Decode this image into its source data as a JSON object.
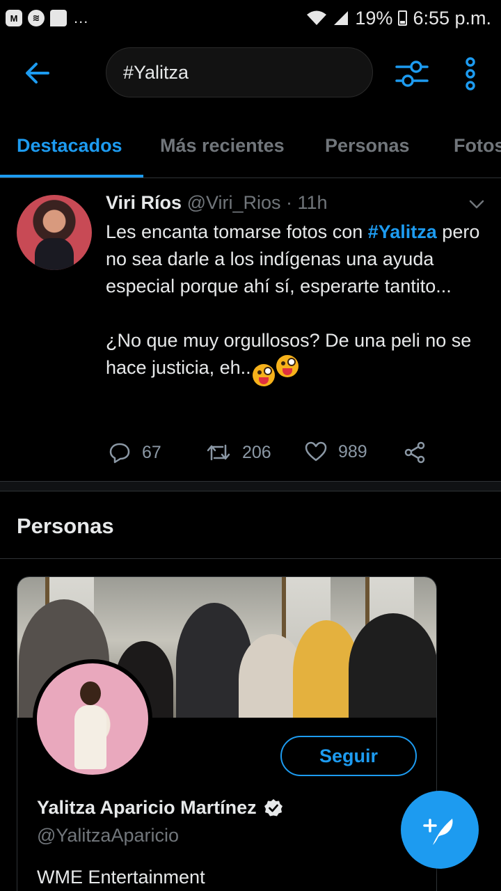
{
  "status_bar": {
    "app_icons": [
      "m-icon",
      "spotify-icon",
      "message-icon"
    ],
    "overflow": "...",
    "battery": "19%",
    "time": "6:55 p.m."
  },
  "search": {
    "query": "#Yalitza"
  },
  "tabs": [
    {
      "label": "Destacados",
      "active": true
    },
    {
      "label": "Más recientes",
      "active": false
    },
    {
      "label": "Personas",
      "active": false
    },
    {
      "label": "Fotos",
      "active": false
    }
  ],
  "tweet": {
    "name": "Viri Ríos",
    "handle": "@Viri_Rios",
    "separator": " · ",
    "time": "11h",
    "text_before": "Les encanta tomarse fotos con ",
    "hashtag": "#Yalitza",
    "text_after": " pero no sea darle a los indígenas una ayuda especial porque ahí sí, esperarte tantito...",
    "text_p2": "¿No que muy orgullosos? De una peli no se hace justicia, eh..",
    "emoji": "😜😜",
    "replies": "67",
    "retweets": "206",
    "likes": "989"
  },
  "personas": {
    "title": "Personas",
    "card": {
      "name": "Yalitza Aparicio Martínez",
      "handle": "@YalitzaAparicio",
      "bio": "WME Entertainment",
      "follow_label": "Seguir",
      "verified": true
    }
  },
  "colors": {
    "accent": "#1d9bf0",
    "background": "#000000",
    "muted": "#71767b"
  }
}
